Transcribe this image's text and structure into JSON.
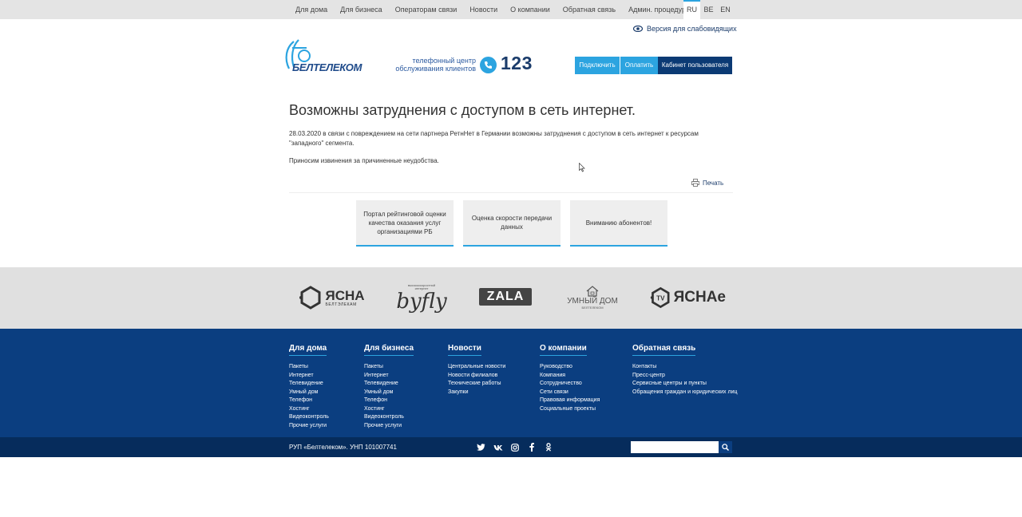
{
  "topnav": {
    "items": [
      "Для дома",
      "Для бизнеса",
      "Операторам связи",
      "Новости",
      "О компании",
      "Обратная связь",
      "Админ. процедуры"
    ],
    "langs": [
      "RU",
      "BE",
      "EN"
    ],
    "active_lang": "RU"
  },
  "header": {
    "low_vision": "Версия для слабовидящих",
    "logo_text": "БЕЛТЕЛЕКОМ",
    "callcenter_line1": "телефонный центр",
    "callcenter_line2": "обслуживания клиентов",
    "phone": "123",
    "btn_connect": "Подключить",
    "btn_pay": "Оплатить",
    "btn_cabinet": "Кабинет пользователя"
  },
  "article": {
    "title": "Возможны затруднения с доступом в сеть интернет.",
    "p1": "28.03.2020 в связи с повреждением на сети партнера РетнНет в Германии возможны затруднения с доступом в сеть интернет к ресурсам \"западного\" сегмента.",
    "p2": "Приносим извинения за причиненные неудобства.",
    "print": "Печать"
  },
  "cards": [
    "Портал рейтинговой оценки качества оказания услуг организациями РБ",
    "Оценка скорости передачи данных",
    "Вниманию абонентов!"
  ],
  "partners": {
    "yasna": "ЯСНА",
    "yasna_sub": "БЕЛТЭЛЕКАМ",
    "byfly": "byfly",
    "byfly_sub": "высокоскоростной интернет",
    "zala": "ZALA",
    "smart": "УМНЫЙ ДОМ",
    "smart_sub": "БЕЛТЕЛЕКОМ",
    "yasnae": "ЯСНАе",
    "yasnae_tv": "TV"
  },
  "footer": {
    "cols": [
      {
        "title": "Для дома",
        "items": [
          "Пакеты",
          "Интернет",
          "Телевидение",
          "Умный дом",
          "Телефон",
          "Хостинг",
          "Видеоконтроль",
          "Прочие услуги"
        ]
      },
      {
        "title": "Для бизнеса",
        "items": [
          "Пакеты",
          "Интернет",
          "Телевидение",
          "Умный дом",
          "Телефон",
          "Хостинг",
          "Видеоконтроль",
          "Прочие услуги"
        ]
      },
      {
        "title": "Новости",
        "items": [
          "Центральные новости",
          "Новости филиалов",
          "Технические работы",
          "Закупки"
        ]
      },
      {
        "title": "О компании",
        "items": [
          "Руководство",
          "Компания",
          "Сотрудничество",
          "Сети связи",
          "Правовая информация",
          "Социальные проекты"
        ]
      },
      {
        "title": "Обратная связь",
        "items": [
          "Контакты",
          "Пресс-центр",
          "Сервисные центры и пункты",
          "Обращения граждан и юридических лиц"
        ]
      }
    ],
    "copyright": "РУП «Белтелеком». УНП 101007741",
    "search_placeholder": ""
  },
  "colors": {
    "accent": "#2ca4e0",
    "dark_blue": "#0b3e80",
    "darker_blue": "#062c5c"
  }
}
